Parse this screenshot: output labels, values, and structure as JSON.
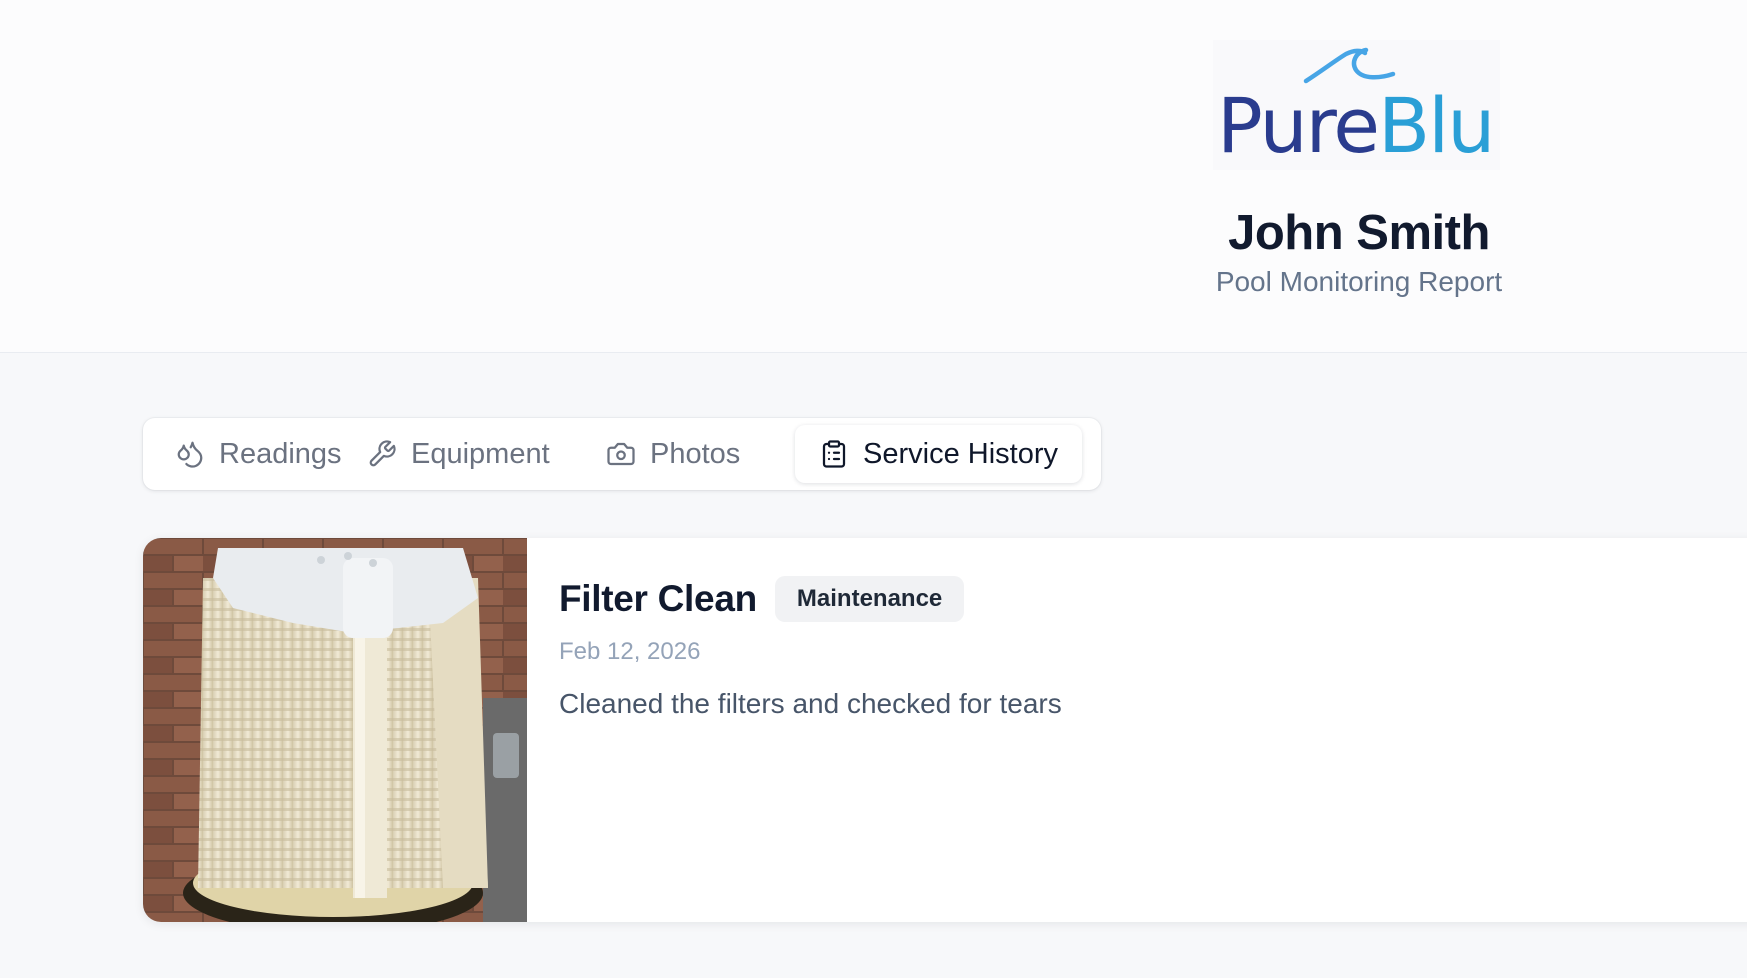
{
  "brand": {
    "name_part1": "Pure",
    "name_part2": "Blu",
    "color_primary": "#2a3c8e",
    "color_secondary": "#2a9fd6",
    "logo_icon": "wave-icon"
  },
  "customer": {
    "name": "John Smith",
    "report_title": "Pool Monitoring Report"
  },
  "tabs": [
    {
      "label": "Readings",
      "icon": "droplets-icon",
      "active": false
    },
    {
      "label": "Equipment",
      "icon": "wrench-icon",
      "active": false
    },
    {
      "label": "Photos",
      "icon": "camera-icon",
      "active": false
    },
    {
      "label": "Service History",
      "icon": "clipboard-list-icon",
      "active": true
    }
  ],
  "service_history": [
    {
      "title": "Filter Clean",
      "type": "Maintenance",
      "date": "Feb 12, 2026",
      "notes": "Cleaned the filters and checked for tears",
      "photo": "pool-filter-cartridge-photo"
    }
  ]
}
